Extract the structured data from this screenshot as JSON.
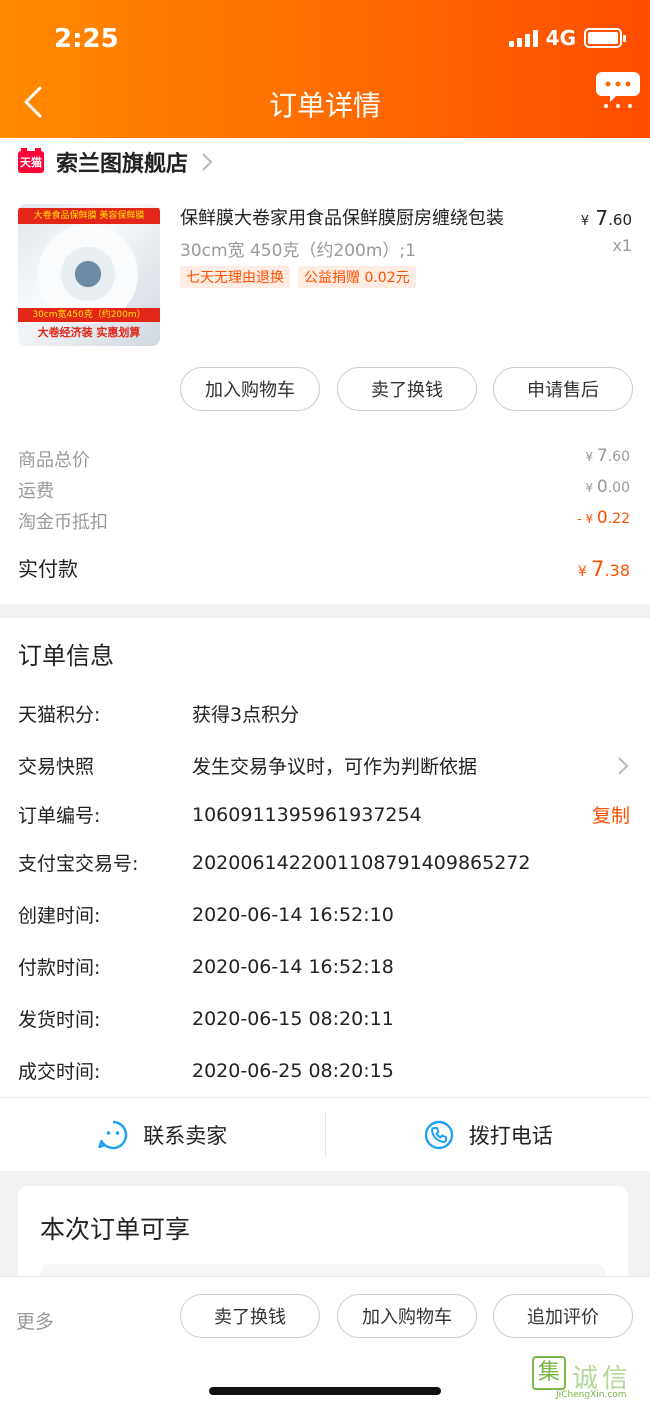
{
  "status_bar": {
    "time": "2:25",
    "network": "4G"
  },
  "header": {
    "title": "订单详情"
  },
  "shop": {
    "badge": "天猫",
    "name": "索兰图旗舰店"
  },
  "product": {
    "title": "保鲜膜大卷家用食品保鲜膜厨房缠绕包装",
    "spec": "30cm宽 450克（约200m）;1",
    "tags": [
      "七天无理由退换",
      "公益捐赠 0.02元"
    ],
    "price_currency": "¥",
    "price_int": "7",
    "price_dec": ".60",
    "quantity": "x1",
    "image_text": {
      "top": "大卷食品保鲜膜 美容保鲜膜",
      "mid": "30cm宽450克（约200m）",
      "bottom": "大卷经济装 实惠划算"
    }
  },
  "item_actions": [
    "加入购物车",
    "卖了换钱",
    "申请售后"
  ],
  "fees": [
    {
      "label": "商品总价",
      "prefix": "¥ ",
      "int": "7",
      "dec": ".60"
    },
    {
      "label": "运费",
      "prefix": "¥ ",
      "int": "0",
      "dec": ".00"
    },
    {
      "label": "淘金币抵扣",
      "prefix": "- ¥ ",
      "int": "0",
      "dec": ".22"
    }
  ],
  "paid": {
    "label": "实付款",
    "prefix": "¥ ",
    "int": "7",
    "dec": ".38"
  },
  "order_info": {
    "title": "订单信息",
    "rows": [
      {
        "label": "天猫积分:",
        "value": "获得3点积分"
      },
      {
        "label": "交易快照",
        "value": "发生交易争议时，可作为判断依据"
      },
      {
        "label": "订单编号:",
        "value": "1060911395961937254",
        "action": "复制"
      },
      {
        "label": "支付宝交易号:",
        "value": "2020061422001108791409865272"
      },
      {
        "label": "创建时间:",
        "value": "2020-06-14 16:52:10"
      },
      {
        "label": "付款时间:",
        "value": "2020-06-14 16:52:18"
      },
      {
        "label": "发货时间:",
        "value": "2020-06-15 08:20:11"
      },
      {
        "label": "成交时间:",
        "value": "2020-06-25 08:20:15"
      }
    ]
  },
  "contact": {
    "seller": "联系卖家",
    "phone": "拨打电话"
  },
  "promo": {
    "title": "本次订单可享"
  },
  "bottom_bar": {
    "more": "更多",
    "buttons": [
      "卖了换钱",
      "加入购物车",
      "追加评价"
    ]
  },
  "watermark": {
    "cn": "诚信",
    "logo": "集",
    "en": "JiChengXin.com"
  },
  "colors": {
    "accent": "#ff5000",
    "header_start": "#ff8a00",
    "header_end": "#ff4d00",
    "icon_blue": "#1da1f2"
  }
}
